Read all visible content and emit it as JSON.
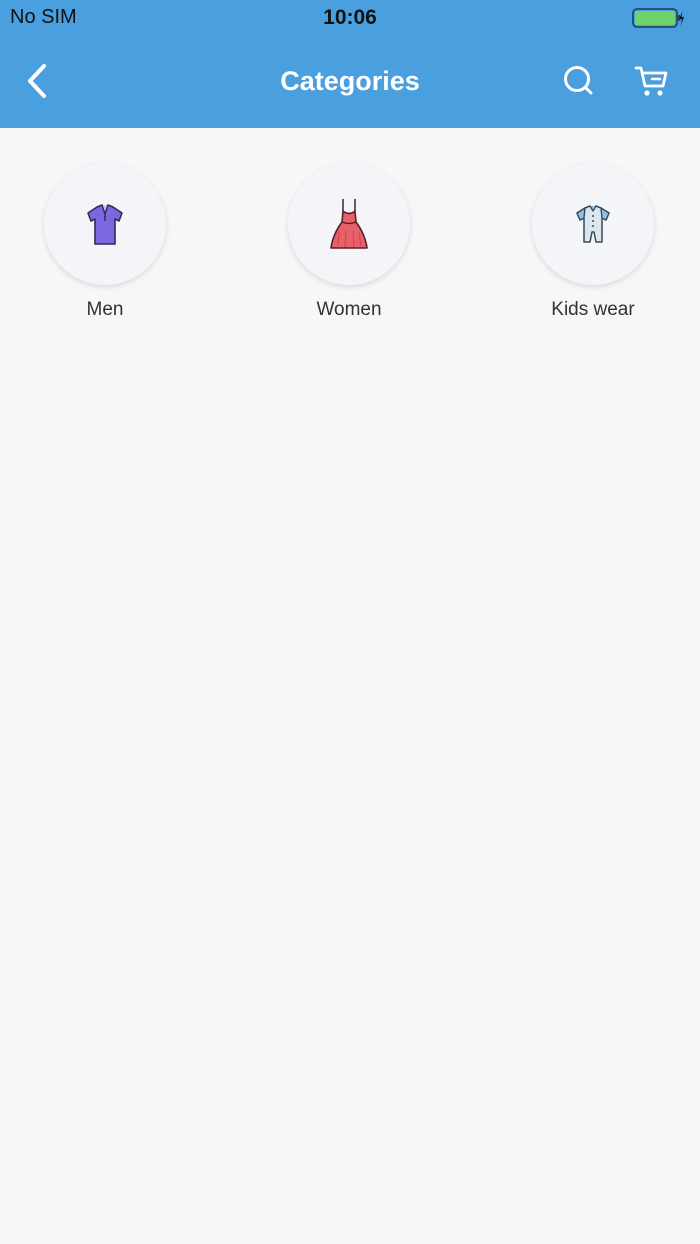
{
  "status_bar": {
    "carrier": "No SIM",
    "time": "10:06"
  },
  "nav": {
    "title": "Categories",
    "back_icon": "chevron-left-icon",
    "search_icon": "search-icon",
    "cart_icon": "cart-icon"
  },
  "categories": [
    {
      "label": "Men",
      "icon": "polo-shirt-icon"
    },
    {
      "label": "Women",
      "icon": "dress-icon"
    },
    {
      "label": "Kids wear",
      "icon": "romper-icon"
    }
  ],
  "colors": {
    "header": "#4a9fdf",
    "background": "#f7f7f7",
    "men_shirt": "#7b68e0",
    "women_dress": "#e8606a",
    "kids_romper": "#8ec3e6",
    "battery_fill": "#6fd36b"
  }
}
